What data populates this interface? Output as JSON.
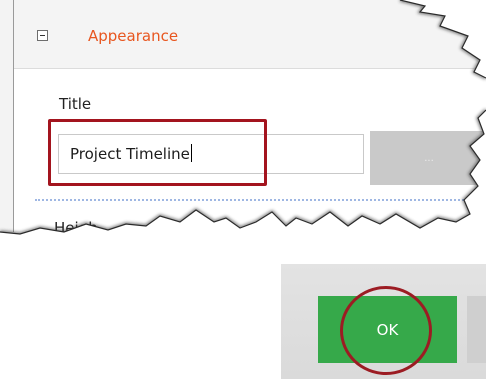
{
  "appearance_section": {
    "title": "Appearance",
    "toggle_icon": "collapse-minus-icon"
  },
  "title_field": {
    "label": "Title",
    "value": "Project Timeline"
  },
  "browse_button": {
    "label": "..."
  },
  "next_field": {
    "label": "Heigh"
  },
  "footer": {
    "ok_label": "OK"
  },
  "colors": {
    "section_title": "#e8561f",
    "highlight": "#a3141e",
    "ok_button": "#36a94a"
  }
}
